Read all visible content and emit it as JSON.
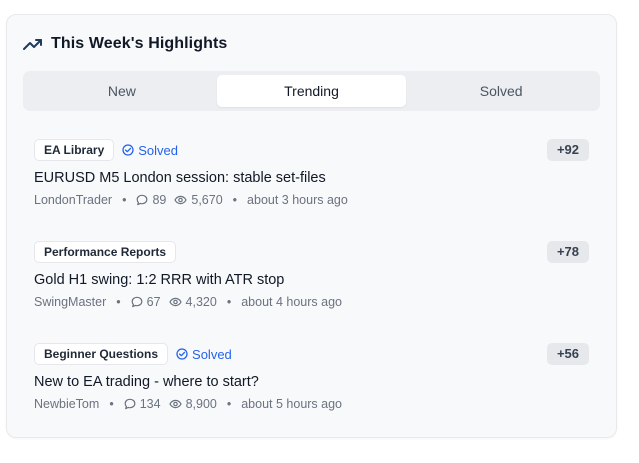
{
  "header": {
    "title": "This Week's Highlights",
    "icon": "trending-up-icon",
    "accent": "#1e3a5f"
  },
  "tabs": [
    {
      "label": "New",
      "active": false
    },
    {
      "label": "Trending",
      "active": true
    },
    {
      "label": "Solved",
      "active": false
    }
  ],
  "posts": [
    {
      "tag": "EA Library",
      "solved": "Solved",
      "title": "EURUSD M5 London session: stable set-files",
      "author": "LondonTrader",
      "comments": "89",
      "views": "5,670",
      "time": "about 3 hours ago",
      "score": "+92"
    },
    {
      "tag": "Performance Reports",
      "solved": "",
      "title": "Gold H1 swing: 1:2 RRR with ATR stop",
      "author": "SwingMaster",
      "comments": "67",
      "views": "4,320",
      "time": "about 4 hours ago",
      "score": "+78"
    },
    {
      "tag": "Beginner Questions",
      "solved": "Solved",
      "title": "New to EA trading - where to start?",
      "author": "NewbieTom",
      "comments": "134",
      "views": "8,900",
      "time": "about 5 hours ago",
      "score": "+56"
    }
  ],
  "colors": {
    "solved": "#2563eb",
    "muted": "#6b7280"
  }
}
